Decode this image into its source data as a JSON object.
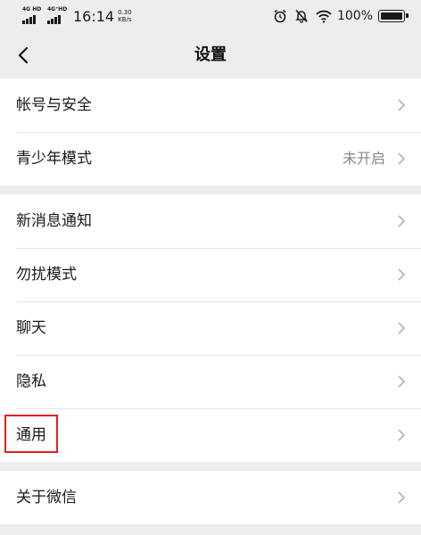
{
  "status_bar": {
    "network_1": "4G HD",
    "network_2": "4G⁺HD",
    "time": "16:14",
    "speed_value": "0.30",
    "speed_unit": "KB/s",
    "battery_text": "100%",
    "battery_level": 1.0,
    "icons": [
      "signal-icon",
      "signal-icon",
      "alarm-icon",
      "mute-bell-icon",
      "wifi-icon",
      "battery-icon"
    ]
  },
  "nav": {
    "title": "设置",
    "back_icon": "chevron-left-icon"
  },
  "groups": [
    {
      "items": [
        {
          "label": "帐号与安全",
          "value": ""
        },
        {
          "label": "青少年模式",
          "value": "未开启"
        }
      ]
    },
    {
      "items": [
        {
          "label": "新消息通知",
          "value": ""
        },
        {
          "label": "勿扰模式",
          "value": ""
        },
        {
          "label": "聊天",
          "value": ""
        },
        {
          "label": "隐私",
          "value": ""
        },
        {
          "label": "通用",
          "value": "",
          "highlighted": true
        }
      ]
    },
    {
      "items": [
        {
          "label": "关于微信",
          "value": ""
        }
      ]
    }
  ],
  "colors": {
    "background": "#ededed",
    "row_background": "#ffffff",
    "highlight": "#e02020",
    "secondary_text": "#888888"
  }
}
